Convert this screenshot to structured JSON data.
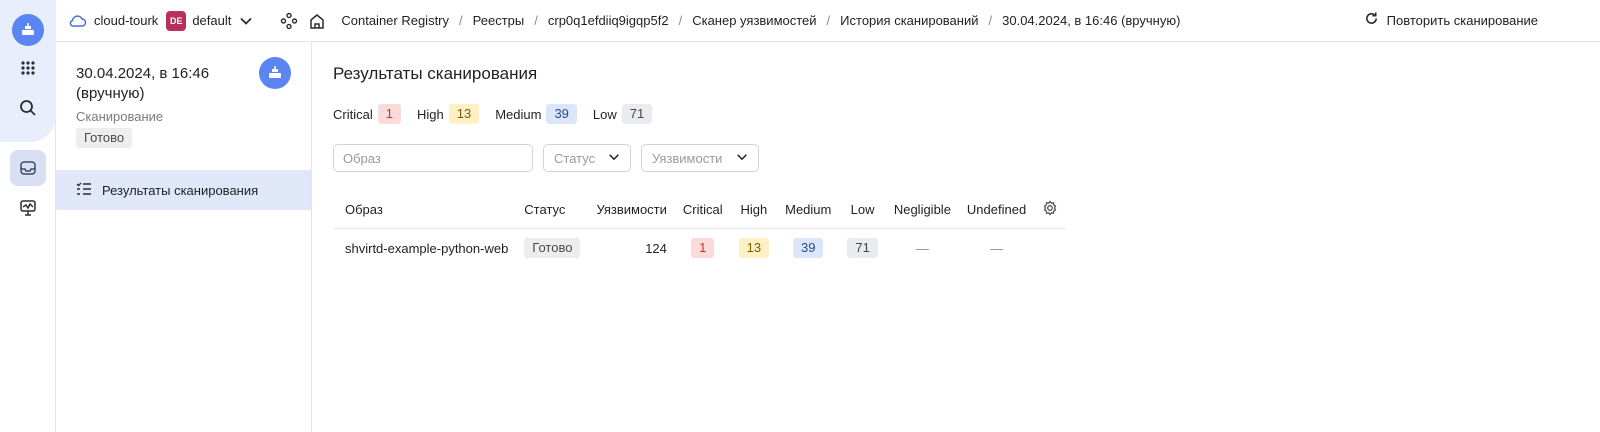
{
  "topbar": {
    "cloud_name": "cloud-tourk",
    "folder_badge": "DE",
    "folder_name": "default",
    "breadcrumbs": [
      "Container Registry",
      "Реестры",
      "crp0q1efdiiq9igqp5f2",
      "Сканер уязвимостей",
      "История сканирований",
      "30.04.2024, в 16:46 (вручную)"
    ],
    "repeat_scan_label": "Повторить сканирование"
  },
  "side": {
    "title": "30.04.2024, в 16:46 (вручную)",
    "subtitle": "Сканирование",
    "status": "Готово",
    "nav_item": "Результаты сканирования"
  },
  "main": {
    "title": "Результаты сканирования",
    "summary": [
      {
        "label": "Critical",
        "count": "1"
      },
      {
        "label": "High",
        "count": "13"
      },
      {
        "label": "Medium",
        "count": "39"
      },
      {
        "label": "Low",
        "count": "71"
      }
    ],
    "filters": {
      "image_placeholder": "Образ",
      "status_placeholder": "Статус",
      "vuln_placeholder": "Уязвимости"
    },
    "table": {
      "headers": [
        "Образ",
        "Статус",
        "Уязвимости",
        "Critical",
        "High",
        "Medium",
        "Low",
        "Negligible",
        "Undefined"
      ],
      "rows": [
        {
          "image": "shvirtd-example-python-web",
          "status": "Готово",
          "vulnerabilities": "124",
          "critical": "1",
          "high": "13",
          "medium": "39",
          "low": "71",
          "negligible": "—",
          "undefined": "—"
        }
      ]
    }
  },
  "colors": {
    "accent": "#5b85f2",
    "critical_bg": "#fbdada",
    "high_bg": "#fdf0c4",
    "medium_bg": "#dbe6fb",
    "low_bg": "#e9ebee",
    "folder_badge": "#b8315b"
  },
  "icons": [
    "container-registry-logo-icon",
    "apps-grid-icon",
    "search-icon",
    "inbox-icon",
    "monitoring-icon",
    "cloud-icon",
    "chevron-down-icon",
    "services-icon",
    "home-icon",
    "refresh-icon",
    "checklist-icon",
    "gear-icon"
  ]
}
